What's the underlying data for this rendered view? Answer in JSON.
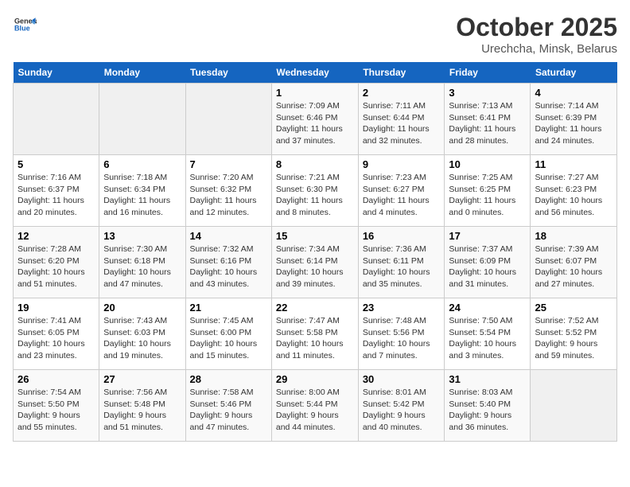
{
  "logo": {
    "line1": "General",
    "line2": "Blue"
  },
  "title": "October 2025",
  "subtitle": "Urechcha, Minsk, Belarus",
  "days_of_week": [
    "Sunday",
    "Monday",
    "Tuesday",
    "Wednesday",
    "Thursday",
    "Friday",
    "Saturday"
  ],
  "weeks": [
    [
      {
        "day": "",
        "info": ""
      },
      {
        "day": "",
        "info": ""
      },
      {
        "day": "",
        "info": ""
      },
      {
        "day": "1",
        "info": "Sunrise: 7:09 AM\nSunset: 6:46 PM\nDaylight: 11 hours and 37 minutes."
      },
      {
        "day": "2",
        "info": "Sunrise: 7:11 AM\nSunset: 6:44 PM\nDaylight: 11 hours and 32 minutes."
      },
      {
        "day": "3",
        "info": "Sunrise: 7:13 AM\nSunset: 6:41 PM\nDaylight: 11 hours and 28 minutes."
      },
      {
        "day": "4",
        "info": "Sunrise: 7:14 AM\nSunset: 6:39 PM\nDaylight: 11 hours and 24 minutes."
      }
    ],
    [
      {
        "day": "5",
        "info": "Sunrise: 7:16 AM\nSunset: 6:37 PM\nDaylight: 11 hours and 20 minutes."
      },
      {
        "day": "6",
        "info": "Sunrise: 7:18 AM\nSunset: 6:34 PM\nDaylight: 11 hours and 16 minutes."
      },
      {
        "day": "7",
        "info": "Sunrise: 7:20 AM\nSunset: 6:32 PM\nDaylight: 11 hours and 12 minutes."
      },
      {
        "day": "8",
        "info": "Sunrise: 7:21 AM\nSunset: 6:30 PM\nDaylight: 11 hours and 8 minutes."
      },
      {
        "day": "9",
        "info": "Sunrise: 7:23 AM\nSunset: 6:27 PM\nDaylight: 11 hours and 4 minutes."
      },
      {
        "day": "10",
        "info": "Sunrise: 7:25 AM\nSunset: 6:25 PM\nDaylight: 11 hours and 0 minutes."
      },
      {
        "day": "11",
        "info": "Sunrise: 7:27 AM\nSunset: 6:23 PM\nDaylight: 10 hours and 56 minutes."
      }
    ],
    [
      {
        "day": "12",
        "info": "Sunrise: 7:28 AM\nSunset: 6:20 PM\nDaylight: 10 hours and 51 minutes."
      },
      {
        "day": "13",
        "info": "Sunrise: 7:30 AM\nSunset: 6:18 PM\nDaylight: 10 hours and 47 minutes."
      },
      {
        "day": "14",
        "info": "Sunrise: 7:32 AM\nSunset: 6:16 PM\nDaylight: 10 hours and 43 minutes."
      },
      {
        "day": "15",
        "info": "Sunrise: 7:34 AM\nSunset: 6:14 PM\nDaylight: 10 hours and 39 minutes."
      },
      {
        "day": "16",
        "info": "Sunrise: 7:36 AM\nSunset: 6:11 PM\nDaylight: 10 hours and 35 minutes."
      },
      {
        "day": "17",
        "info": "Sunrise: 7:37 AM\nSunset: 6:09 PM\nDaylight: 10 hours and 31 minutes."
      },
      {
        "day": "18",
        "info": "Sunrise: 7:39 AM\nSunset: 6:07 PM\nDaylight: 10 hours and 27 minutes."
      }
    ],
    [
      {
        "day": "19",
        "info": "Sunrise: 7:41 AM\nSunset: 6:05 PM\nDaylight: 10 hours and 23 minutes."
      },
      {
        "day": "20",
        "info": "Sunrise: 7:43 AM\nSunset: 6:03 PM\nDaylight: 10 hours and 19 minutes."
      },
      {
        "day": "21",
        "info": "Sunrise: 7:45 AM\nSunset: 6:00 PM\nDaylight: 10 hours and 15 minutes."
      },
      {
        "day": "22",
        "info": "Sunrise: 7:47 AM\nSunset: 5:58 PM\nDaylight: 10 hours and 11 minutes."
      },
      {
        "day": "23",
        "info": "Sunrise: 7:48 AM\nSunset: 5:56 PM\nDaylight: 10 hours and 7 minutes."
      },
      {
        "day": "24",
        "info": "Sunrise: 7:50 AM\nSunset: 5:54 PM\nDaylight: 10 hours and 3 minutes."
      },
      {
        "day": "25",
        "info": "Sunrise: 7:52 AM\nSunset: 5:52 PM\nDaylight: 9 hours and 59 minutes."
      }
    ],
    [
      {
        "day": "26",
        "info": "Sunrise: 7:54 AM\nSunset: 5:50 PM\nDaylight: 9 hours and 55 minutes."
      },
      {
        "day": "27",
        "info": "Sunrise: 7:56 AM\nSunset: 5:48 PM\nDaylight: 9 hours and 51 minutes."
      },
      {
        "day": "28",
        "info": "Sunrise: 7:58 AM\nSunset: 5:46 PM\nDaylight: 9 hours and 47 minutes."
      },
      {
        "day": "29",
        "info": "Sunrise: 8:00 AM\nSunset: 5:44 PM\nDaylight: 9 hours and 44 minutes."
      },
      {
        "day": "30",
        "info": "Sunrise: 8:01 AM\nSunset: 5:42 PM\nDaylight: 9 hours and 40 minutes."
      },
      {
        "day": "31",
        "info": "Sunrise: 8:03 AM\nSunset: 5:40 PM\nDaylight: 9 hours and 36 minutes."
      },
      {
        "day": "",
        "info": ""
      }
    ]
  ]
}
